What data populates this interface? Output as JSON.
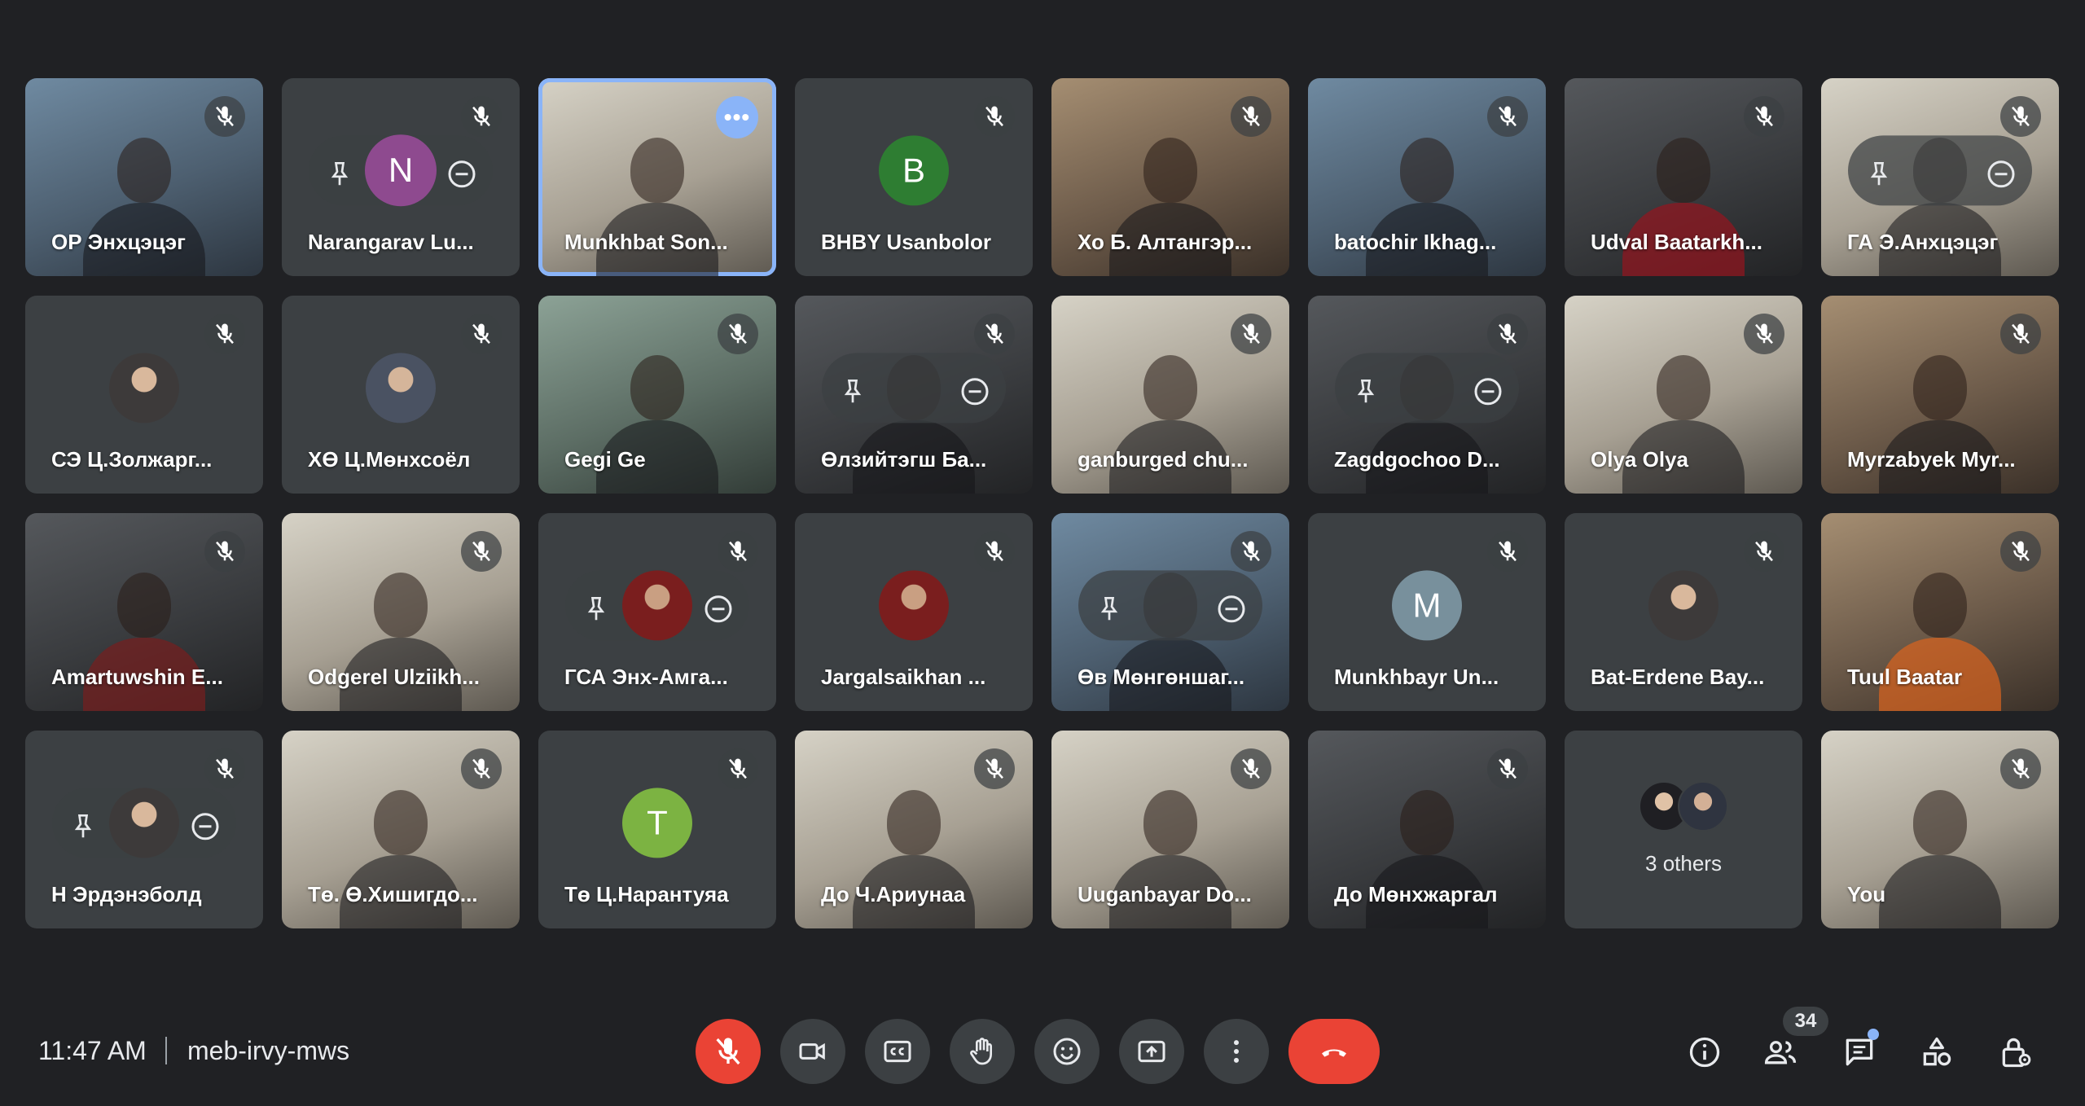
{
  "meeting": {
    "time": "11:47 AM",
    "code": "meb-irvy-mws",
    "people_count": "34"
  },
  "participants": [
    {
      "name": "ОР Энхцэцэг"
    },
    {
      "name": "Narangarav Lu...",
      "initial": "N"
    },
    {
      "name": "Munkhbat Son..."
    },
    {
      "name": "BHBY Usanbolor",
      "initial": "B"
    },
    {
      "name": "Хо Б. Алтангэр..."
    },
    {
      "name": "batochir Ikhag..."
    },
    {
      "name": "Udval Baatarkh..."
    },
    {
      "name": "ГА Э.Анхцэцэг"
    },
    {
      "name": "СЭ Ц.Золжарг..."
    },
    {
      "name": "ХӨ Ц.Мөнхсоёл"
    },
    {
      "name": "Gegi Ge"
    },
    {
      "name": "Өлзийтэгш Ба..."
    },
    {
      "name": "ganburged chu..."
    },
    {
      "name": "Zagdgochoo D..."
    },
    {
      "name": "Olya Olya"
    },
    {
      "name": "Myrzabyek Myr..."
    },
    {
      "name": "Amartuwshin E..."
    },
    {
      "name": "Odgerel Ulziikh..."
    },
    {
      "name": "ГСА Энх-Амга..."
    },
    {
      "name": "Jargalsaikhan ..."
    },
    {
      "name": "Өв Мөнгөншаг..."
    },
    {
      "name": "Munkhbayr Un...",
      "initial": "M"
    },
    {
      "name": "Bat-Erdene Bay..."
    },
    {
      "name": "Tuul Baatar"
    },
    {
      "name": "Н Эрдэнэболд"
    },
    {
      "name": "Тө. Ө.Хишигдо..."
    },
    {
      "name": "Тө Ц.Нарантуяа",
      "initial": "T"
    },
    {
      "name": "До Ч.Ариунаа"
    },
    {
      "name": "Uuganbayar Do..."
    },
    {
      "name": "До Мөнхжаргал"
    },
    {
      "name": "3 others"
    },
    {
      "name": "You"
    }
  ],
  "colors": {
    "background": "#202124",
    "tile": "#3c4043",
    "active_outline": "#8ab4f8",
    "end_call": "#ea4335",
    "avatar_green": "#2e7d32",
    "avatar_olive": "#7cb342",
    "avatar_purple": "#8e4a8f",
    "avatar_slate": "#78909c"
  },
  "icons": {
    "tile": [
      "mic-off-icon",
      "pin-icon",
      "remove-icon",
      "more-options-icon"
    ],
    "controls": [
      "mic-off-icon",
      "camera-icon",
      "captions-icon",
      "raise-hand-icon",
      "emoji-icon",
      "present-screen-icon",
      "more-vert-icon",
      "end-call-icon"
    ],
    "right_panel": [
      "info-icon",
      "people-icon",
      "chat-icon",
      "activities-icon",
      "host-controls-icon"
    ]
  }
}
